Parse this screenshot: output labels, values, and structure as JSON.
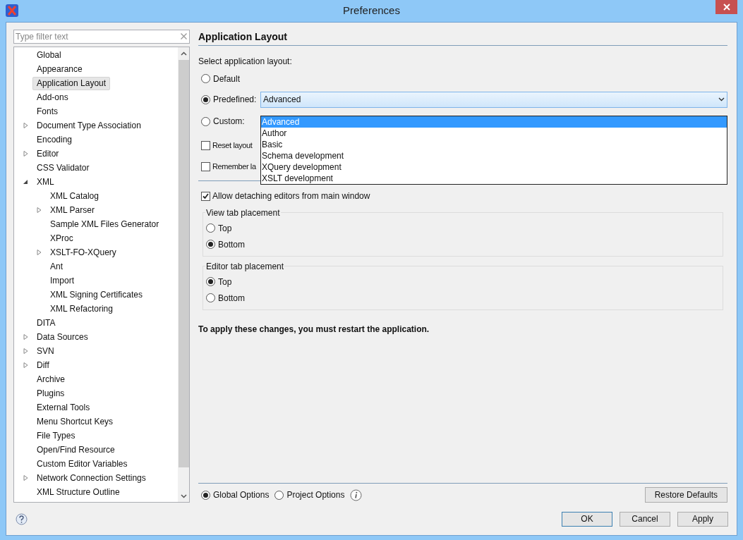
{
  "window": {
    "title": "Preferences"
  },
  "filter": {
    "placeholder": "Type filter text"
  },
  "tree": [
    {
      "label": "Global",
      "selected": false
    },
    {
      "label": "Appearance",
      "selected": false
    },
    {
      "label": "Application Layout",
      "selected": true
    },
    {
      "label": "Add-ons",
      "selected": false
    },
    {
      "label": "Fonts",
      "selected": false
    },
    {
      "label": "Document Type Association",
      "selected": false,
      "expanded": false
    },
    {
      "label": "Encoding",
      "selected": false
    },
    {
      "label": "Editor",
      "selected": false,
      "expanded": false
    },
    {
      "label": "CSS Validator",
      "selected": false
    },
    {
      "label": "XML",
      "selected": false,
      "expanded": true,
      "children": [
        {
          "label": "XML Catalog",
          "selected": false
        },
        {
          "label": "XML Parser",
          "selected": false,
          "expanded": false
        },
        {
          "label": "Sample XML Files Generator",
          "selected": false
        },
        {
          "label": "XProc",
          "selected": false
        },
        {
          "label": "XSLT-FO-XQuery",
          "selected": false,
          "expanded": false
        },
        {
          "label": "Ant",
          "selected": false
        },
        {
          "label": "Import",
          "selected": false
        },
        {
          "label": "XML Signing Certificates",
          "selected": false
        },
        {
          "label": "XML Refactoring",
          "selected": false
        }
      ]
    },
    {
      "label": "DITA",
      "selected": false
    },
    {
      "label": "Data Sources",
      "selected": false,
      "expanded": false
    },
    {
      "label": "SVN",
      "selected": false,
      "expanded": false
    },
    {
      "label": "Diff",
      "selected": false,
      "expanded": false
    },
    {
      "label": "Archive",
      "selected": false
    },
    {
      "label": "Plugins",
      "selected": false
    },
    {
      "label": "External Tools",
      "selected": false
    },
    {
      "label": "Menu Shortcut Keys",
      "selected": false
    },
    {
      "label": "File Types",
      "selected": false
    },
    {
      "label": "Open/Find Resource",
      "selected": false
    },
    {
      "label": "Custom Editor Variables",
      "selected": false
    },
    {
      "label": "Network Connection Settings",
      "selected": false,
      "expanded": false
    },
    {
      "label": "XML Structure Outline",
      "selected": false
    }
  ],
  "page": {
    "title": "Application Layout",
    "prompt": "Select application layout:",
    "layout_options": [
      {
        "label": "Default",
        "selected": false
      },
      {
        "label": "Predefined:",
        "selected": true
      },
      {
        "label": "Custom:",
        "selected": false
      }
    ],
    "predefined": {
      "value": "Advanced",
      "expanded": true,
      "options": [
        {
          "label": "Advanced",
          "selected": true
        },
        {
          "label": "Author",
          "selected": false
        },
        {
          "label": "Basic",
          "selected": false
        },
        {
          "label": "Schema development",
          "selected": false
        },
        {
          "label": "XQuery development",
          "selected": false
        },
        {
          "label": "XSLT development",
          "selected": false
        }
      ]
    },
    "layout_checkboxes": [
      {
        "label": "Reset layout",
        "checked": false
      },
      {
        "label": "Remember la",
        "checked": false
      }
    ],
    "detach": {
      "label": "Allow detaching editors from main window",
      "checked": true
    },
    "groups": [
      {
        "title": "View tab placement",
        "options": [
          {
            "label": "Top",
            "selected": false
          },
          {
            "label": "Bottom",
            "selected": true
          }
        ]
      },
      {
        "title": "Editor tab placement",
        "options": [
          {
            "label": "Top",
            "selected": true
          },
          {
            "label": "Bottom",
            "selected": false
          }
        ]
      }
    ],
    "notice": "To apply these changes, you must restart the application."
  },
  "scope": [
    {
      "label": "Global Options",
      "selected": true
    },
    {
      "label": "Project Options",
      "selected": false
    }
  ],
  "restore_button": "Restore Defaults",
  "buttons": [
    {
      "label": "OK",
      "default": true
    },
    {
      "label": "Cancel",
      "default": false
    },
    {
      "label": "Apply",
      "default": false
    }
  ]
}
